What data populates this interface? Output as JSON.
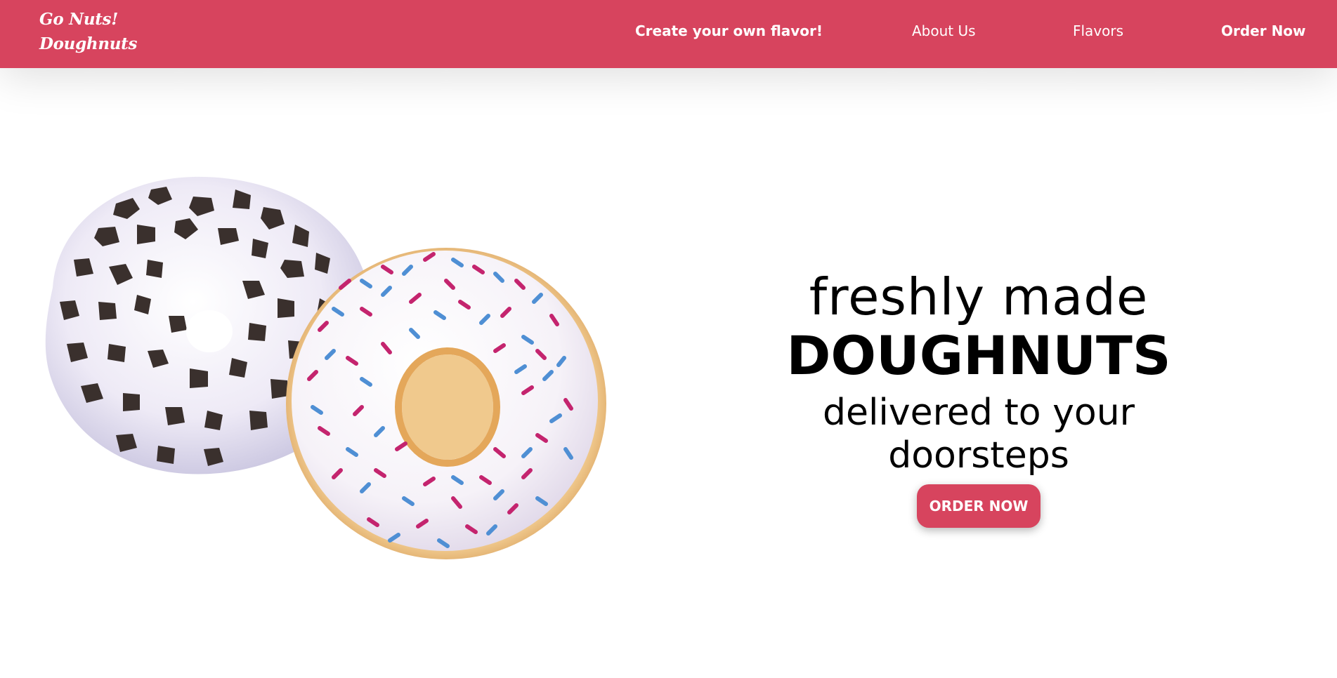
{
  "brand": {
    "logo_line1": "Go Nuts!",
    "logo_line2": "Doughnuts",
    "primary_color": "#d7445e"
  },
  "nav": {
    "create_flavor": "Create your own flavor!",
    "about": "About Us",
    "flavors": "Flavors",
    "order": "Order Now"
  },
  "hero": {
    "line1": "freshly made",
    "line2": "DOUGHNUTS",
    "line3": "delivered to your doorsteps",
    "cta_label": "ORDER NOW",
    "image_icon": "doughnuts-image"
  }
}
